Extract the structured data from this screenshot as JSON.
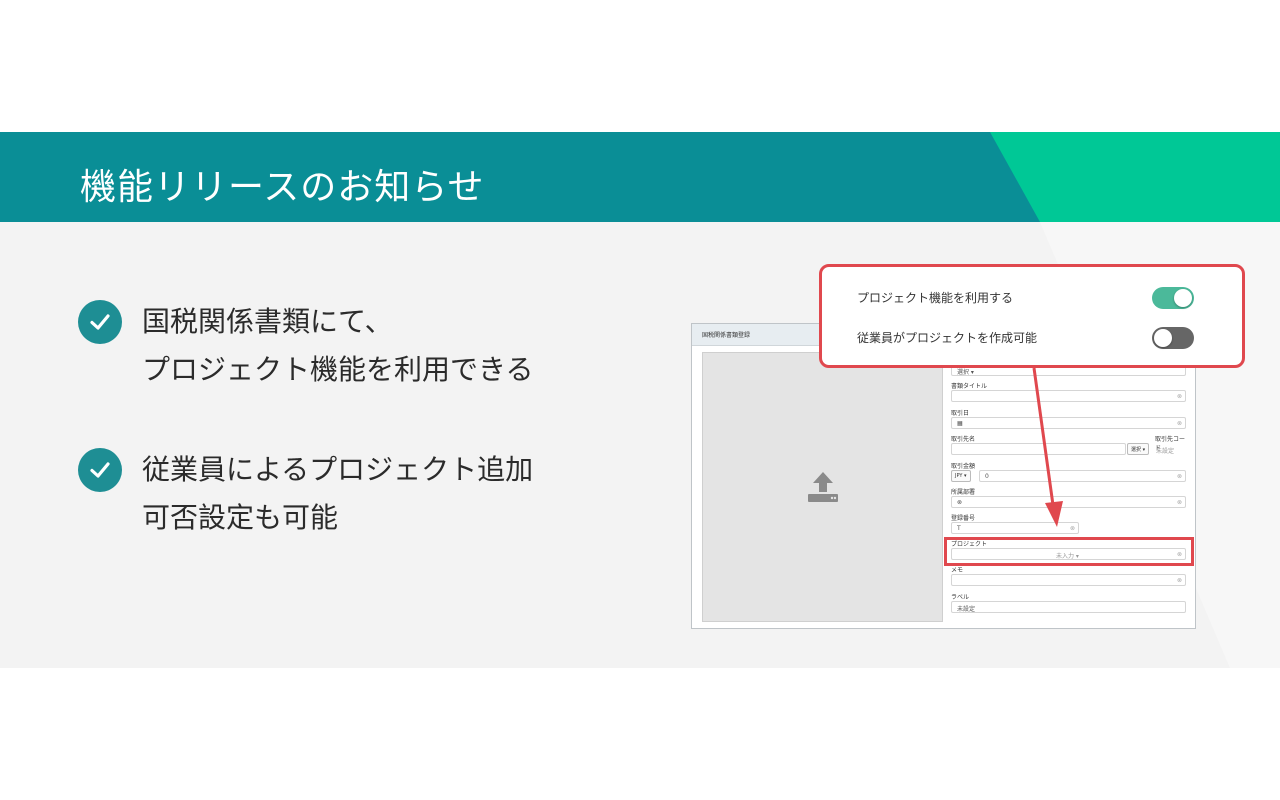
{
  "header": {
    "title": "機能リリースのお知らせ"
  },
  "points": [
    {
      "line1": "国税関係書類にて、",
      "line2": "プロジェクト機能を利用できる"
    },
    {
      "line1": "従業員によるプロジェクト追加",
      "line2": "可否設定も可能"
    }
  ],
  "screenshot": {
    "header_title": "国税関係書類登録",
    "fields": {
      "select_value": "選択 ▾",
      "doc_title_label": "書類タイトル",
      "date_label": "取引日",
      "partner_label": "取引先名",
      "partner_code_label": "取引先コード",
      "partner_select": "選択 ▾",
      "partner_code_value": "未設定",
      "amount_label": "取引金額",
      "currency": "JPY ▾",
      "amount_value": "0",
      "department_label": "所属部署",
      "reg_number_label": "登録番号",
      "reg_number_value": "T",
      "project_label": "プロジェクト",
      "project_value": "未入力 ▾",
      "memo_label": "メモ",
      "label_label": "ラベル",
      "label_value": "未設定"
    }
  },
  "popup": {
    "use_project_label": "プロジェクト機能を利用する",
    "employee_create_label": "従業員がプロジェクトを作成可能",
    "use_project_on": true,
    "employee_create_on": false
  },
  "colors": {
    "header_teal": "#0a8e96",
    "accent_green": "#00c896",
    "check_teal": "#1e8e94",
    "highlight_red": "#e0484e",
    "toggle_on": "#4bb99a",
    "toggle_off": "#666666"
  }
}
